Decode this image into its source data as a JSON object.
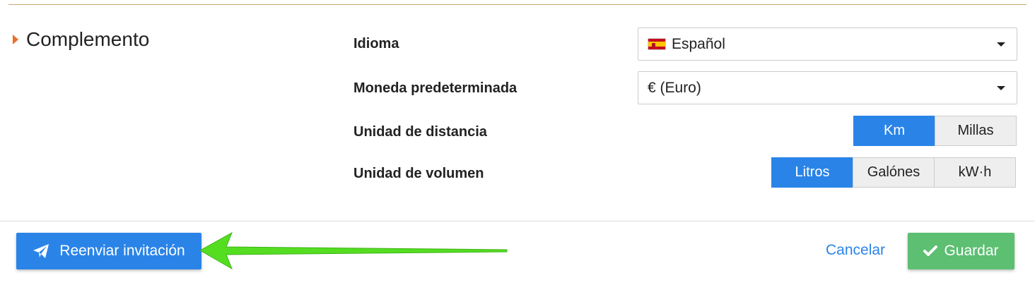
{
  "section": {
    "title": "Complemento"
  },
  "fields": {
    "language": {
      "label": "Idioma",
      "value": "Español",
      "flag_icon": "spain-flag-icon"
    },
    "currency": {
      "label": "Moneda predeterminada",
      "value": "€ (Euro)"
    },
    "distance": {
      "label": "Unidad de distancia",
      "options": [
        "Km",
        "Millas"
      ],
      "selected": "Km"
    },
    "volume": {
      "label": "Unidad de volumen",
      "options": [
        "Litros",
        "Galónes",
        "kW·h"
      ],
      "selected": "Litros"
    }
  },
  "footer": {
    "resend_label": "Reenviar invitación",
    "resend_icon": "paper-plane-icon",
    "cancel_label": "Cancelar",
    "save_label": "Guardar",
    "save_icon": "checkmark-icon"
  },
  "annotation": {
    "type": "green-arrow",
    "color": "#55dd22"
  },
  "colors": {
    "accent_blue": "#2a84e8",
    "save_green": "#5cbf72",
    "caret_orange": "#e8702a",
    "rule_gold": "#c9a96e"
  }
}
